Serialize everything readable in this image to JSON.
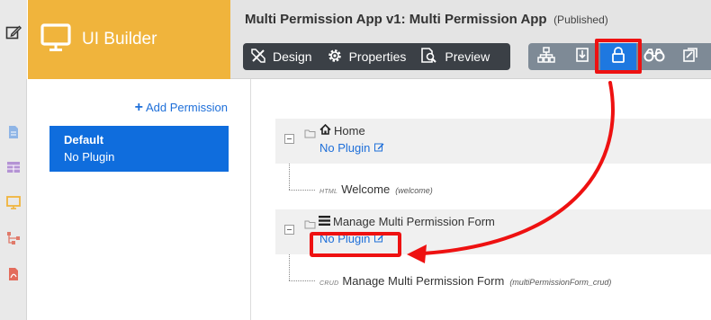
{
  "brand": {
    "name": "UI Builder",
    "icon": "monitor-icon"
  },
  "header": {
    "title": "Multi Permission App v1: Multi Permission App",
    "status": "(Published)"
  },
  "toolbar": {
    "main": [
      {
        "label": "Design",
        "icon": "design-tools-icon"
      },
      {
        "label": "Properties",
        "icon": "gear-icon"
      },
      {
        "label": "Preview",
        "icon": "preview-icon"
      }
    ],
    "side": [
      "sitemap-icon",
      "import-icon",
      "lock-icon",
      "binoculars-icon",
      "export-icon"
    ],
    "active_side": "lock-icon"
  },
  "rail": [
    "edit-icon",
    "document-icon",
    "table-icon",
    "monitor-icon",
    "tree-icon",
    "pdf-icon"
  ],
  "left": {
    "add_permission": "Add Permission",
    "permissions": [
      {
        "name": "Default",
        "plugin": "No Plugin"
      }
    ]
  },
  "tree": {
    "nodes": [
      {
        "label": "Home",
        "icon": "home-icon",
        "plugin": "No Plugin",
        "children": [
          {
            "tag": "HTML",
            "name": "Welcome",
            "id": "(welcome)"
          }
        ]
      },
      {
        "label": "Manage Multi Permission Form",
        "icon": "list-icon",
        "plugin": "No Plugin",
        "children": [
          {
            "tag": "CRUD",
            "name": "Manage Multi Permission Form",
            "id": "(multiPermissionForm_crud)"
          }
        ]
      }
    ]
  },
  "colors": {
    "brand": "#f0b43c",
    "accent": "#0f6ddd",
    "link": "#1e6fd9",
    "highlight": "#ee1111",
    "toolbar_dark": "#3b4046"
  }
}
